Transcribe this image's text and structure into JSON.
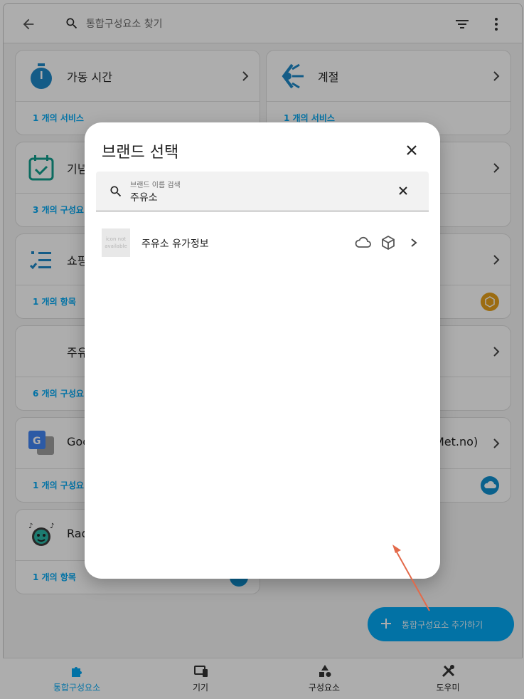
{
  "topbar": {
    "search_placeholder": "통합구성요소 찾기"
  },
  "cards": [
    {
      "name": "가동 시간",
      "footer": "1 개의 서비스"
    },
    {
      "name": "계절",
      "footer": "1 개의 서비스"
    },
    {
      "name": "기념",
      "footer": "3 개의 구성요"
    },
    {
      "name": "",
      "footer": ""
    },
    {
      "name": "쇼핑",
      "footer": "1 개의 항목"
    },
    {
      "name": "",
      "footer": ""
    },
    {
      "name": "주유",
      "footer": "6 개의 구성요"
    },
    {
      "name": "",
      "footer": ""
    },
    {
      "name": "Goo",
      "footer": "1 개의 구성요"
    },
    {
      "name": "Met.no)",
      "footer": ""
    },
    {
      "name": "Rad",
      "footer": "1 개의 항목"
    }
  ],
  "dialog": {
    "title": "브랜드 선택",
    "search_label": "브랜드 이름 검색",
    "search_value": "주유소",
    "results": [
      {
        "name": "주유소 유가정보",
        "thumb_text": "icon not available"
      }
    ]
  },
  "fab": {
    "label": "통합구성요소 추가하기"
  },
  "bottomnav": [
    {
      "label": "통합구성요소",
      "active": true
    },
    {
      "label": "기기",
      "active": false
    },
    {
      "label": "구성요소",
      "active": false
    },
    {
      "label": "도우미",
      "active": false
    }
  ],
  "colors": {
    "accent": "#03a9f4",
    "badge_orange": "#e6a01a",
    "arrow": "#e36a4a"
  }
}
